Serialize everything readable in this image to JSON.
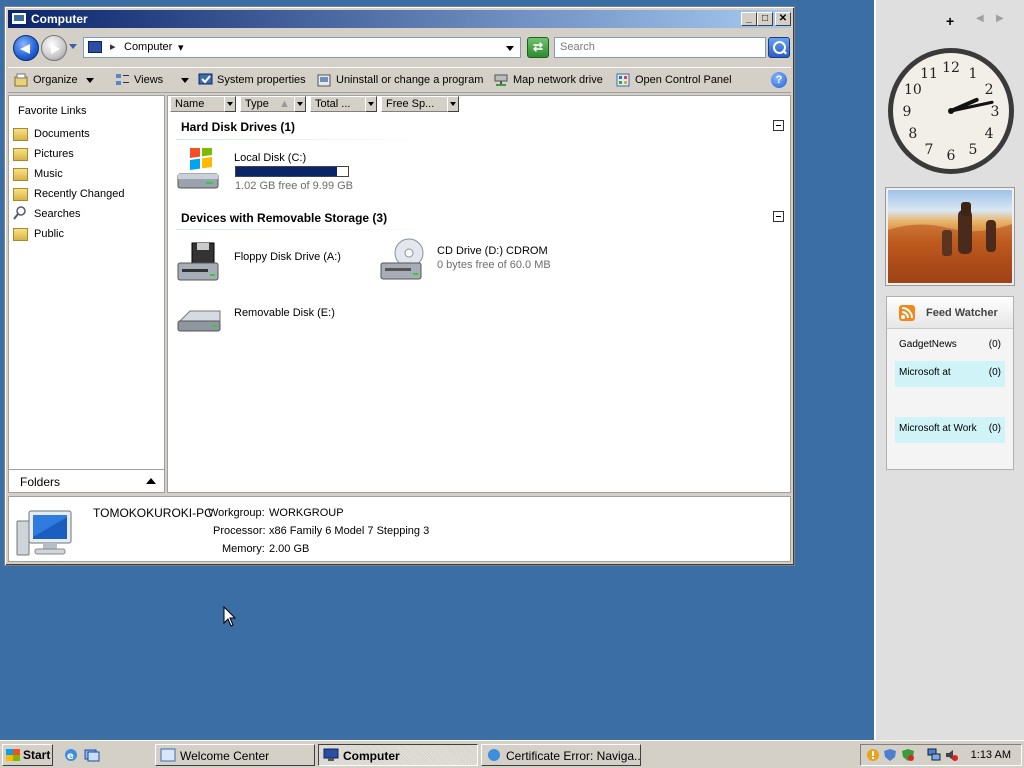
{
  "window": {
    "title": "Computer",
    "controls": {
      "minimize": "_",
      "maximize": "□",
      "close": "✕"
    }
  },
  "address_bar": {
    "path": "Computer",
    "search_placeholder": "Search"
  },
  "toolbar": {
    "organize": "Organize",
    "views": "Views",
    "system_properties": "System properties",
    "uninstall": "Uninstall or change a program",
    "map_drive": "Map network drive",
    "control_panel": "Open Control Panel",
    "help": "?"
  },
  "nav_pane": {
    "header": "Favorite Links",
    "items": [
      {
        "label": "Documents",
        "icon": "folder-icon"
      },
      {
        "label": "Pictures",
        "icon": "folder-icon"
      },
      {
        "label": "Music",
        "icon": "music-folder-icon"
      },
      {
        "label": "Recently Changed",
        "icon": "folder-icon"
      },
      {
        "label": "Searches",
        "icon": "search-icon"
      },
      {
        "label": "Public",
        "icon": "folder-icon"
      }
    ],
    "folders_label": "Folders"
  },
  "columns": [
    "Name",
    "Type",
    "Total ...",
    "Free Sp..."
  ],
  "groups": {
    "hard_disks": {
      "title": "Hard Disk Drives (1)",
      "drives": [
        {
          "name": "Local Disk (C:)",
          "sub": "1.02 GB free of 9.99 GB",
          "used_fraction": 0.898
        }
      ]
    },
    "removable": {
      "title": "Devices with Removable Storage (3)",
      "drives": [
        {
          "name": "Floppy Disk Drive (A:)",
          "sub": ""
        },
        {
          "name": "CD Drive (D:) CDROM",
          "sub": "0 bytes free of 60.0 MB"
        },
        {
          "name": "Removable Disk (E:)",
          "sub": ""
        }
      ]
    }
  },
  "details": {
    "computer_name": "TOMOKOKUROKI-PC",
    "workgroup_label": "Workgroup:",
    "workgroup": "WORKGROUP",
    "processor_label": "Processor:",
    "processor": "x86 Family 6 Model 7 Stepping 3",
    "memory_label": "Memory:",
    "memory": "2.00 GB"
  },
  "sidebar": {
    "add": "+",
    "prev": "◀",
    "next": "▶",
    "clock": {
      "hour": 2,
      "minute": 13,
      "numerals": [
        "12",
        "1",
        "2",
        "3",
        "4",
        "5",
        "6",
        "7",
        "8",
        "9",
        "10",
        "11"
      ]
    },
    "feed": {
      "title": "Feed Watcher",
      "items": [
        {
          "name": "GadgetNews",
          "count": "(0)",
          "highlight": false
        },
        {
          "name": "Microsoft at",
          "count": "(0)",
          "highlight": true
        },
        {
          "name": "",
          "count": "",
          "highlight": false
        },
        {
          "name": "Microsoft at Work",
          "count": "(0)",
          "highlight": true
        }
      ]
    }
  },
  "taskbar": {
    "start": "Start",
    "tasks": [
      {
        "label": "Welcome Center",
        "active": false
      },
      {
        "label": "Computer",
        "active": true
      },
      {
        "label": "Certificate Error: Naviga...",
        "active": false
      }
    ],
    "time": "1:13 AM"
  },
  "colors": {
    "desktop": "#3a6ea5",
    "title_gradient_start": "#0a246a",
    "title_gradient_end": "#a6caf0",
    "disk_bar": "#0a246a",
    "feed_highlight": "#cff3f7"
  }
}
